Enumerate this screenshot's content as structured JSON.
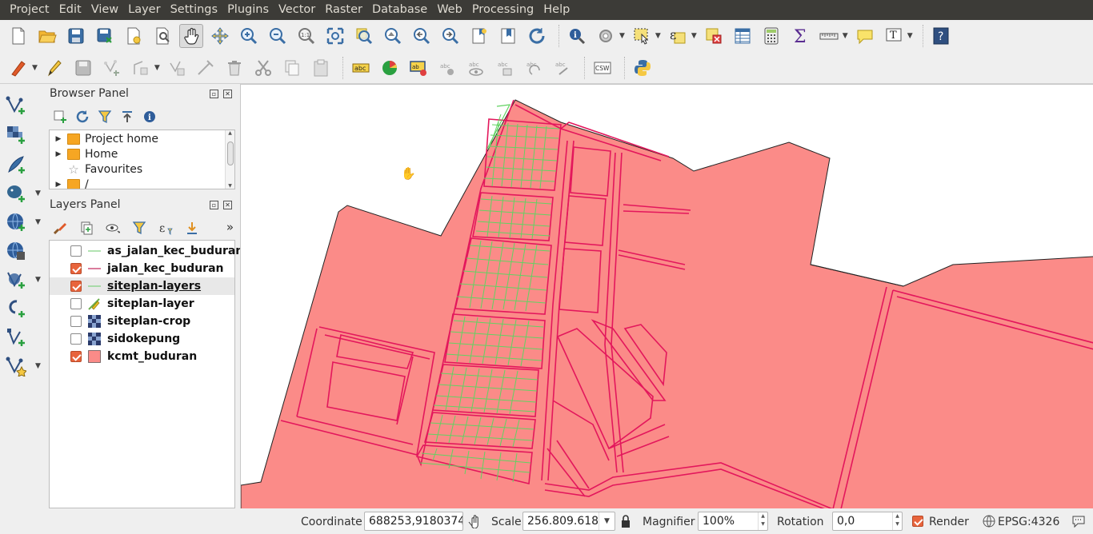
{
  "menu": [
    "Project",
    "Edit",
    "View",
    "Layer",
    "Settings",
    "Plugins",
    "Vector",
    "Raster",
    "Database",
    "Web",
    "Processing",
    "Help"
  ],
  "toolbar_top": {
    "icons": [
      "new-project",
      "open-project",
      "save-project",
      "save-as",
      "print-composer",
      "composer-manager",
      "pan-map",
      "pan-to-selection",
      "zoom-in",
      "zoom-out",
      "zoom-native",
      "zoom-full",
      "zoom-to-selection",
      "zoom-to-layer",
      "zoom-last",
      "zoom-next",
      "new-bookmark",
      "show-bookmarks",
      "refresh",
      "identify",
      "action",
      "select-features",
      "select-by-expression",
      "deselect-all",
      "attribute-table",
      "field-calculator",
      "statistics",
      "measure",
      "map-tips",
      "text-annotation",
      "help"
    ]
  },
  "toolbar_second": {
    "icons": [
      "current-edits",
      "toggle-editing",
      "save-edits",
      "add-feature",
      "move-feature",
      "node-tool",
      "delete-selected",
      "cut-features",
      "copy-features",
      "paste-features",
      "label-tool",
      "diagram-tool",
      "pin-labels",
      "show-hide-labels",
      "move-label",
      "rotate-label",
      "change-label",
      "csw-search",
      "python-console"
    ],
    "csw_label": "CSW"
  },
  "browser_panel": {
    "title": "Browser Panel",
    "items": [
      {
        "label": "Project home",
        "type": "folder",
        "expandable": true
      },
      {
        "label": "Home",
        "type": "folder",
        "expandable": true
      },
      {
        "label": "Favourites",
        "type": "star",
        "expandable": false
      },
      {
        "label": "/",
        "type": "folder",
        "expandable": true
      }
    ]
  },
  "layers_panel": {
    "title": "Layers Panel",
    "more": "»",
    "layers": [
      {
        "name": "as_jalan_kec_buduran",
        "checked": false,
        "symbol": "line",
        "color": "#7ed07e"
      },
      {
        "name": "jalan_kec_buduran",
        "checked": true,
        "symbol": "line",
        "color": "#c0245a"
      },
      {
        "name": "siteplan-layers",
        "checked": true,
        "symbol": "line",
        "color": "#7ed07e",
        "selected": true,
        "editing": true
      },
      {
        "name": "siteplan-layer",
        "checked": false,
        "symbol": "pencil-line",
        "color": "#e0c020"
      },
      {
        "name": "siteplan-crop",
        "checked": false,
        "symbol": "raster",
        "color": "#2a3a6a"
      },
      {
        "name": "sidokepung",
        "checked": false,
        "symbol": "raster",
        "color": "#2a3a6a"
      },
      {
        "name": "kcmt_buduran",
        "checked": true,
        "symbol": "polygon",
        "color": "#fb8b88"
      }
    ]
  },
  "map": {
    "polygon_fill": "#fb8b88",
    "road_color": "#e3175c",
    "plot_color": "#62d262"
  },
  "statusbar": {
    "coordinate_label": "Coordinate",
    "coordinate_value": "688253,9180374",
    "scale_label": "Scale",
    "scale_value": "256.809.618",
    "magnifier_label": "Magnifier",
    "magnifier_value": "100%",
    "rotation_label": "Rotation",
    "rotation_value": "0,0",
    "render_label": "Render",
    "render_checked": true,
    "crs": "EPSG:4326"
  }
}
